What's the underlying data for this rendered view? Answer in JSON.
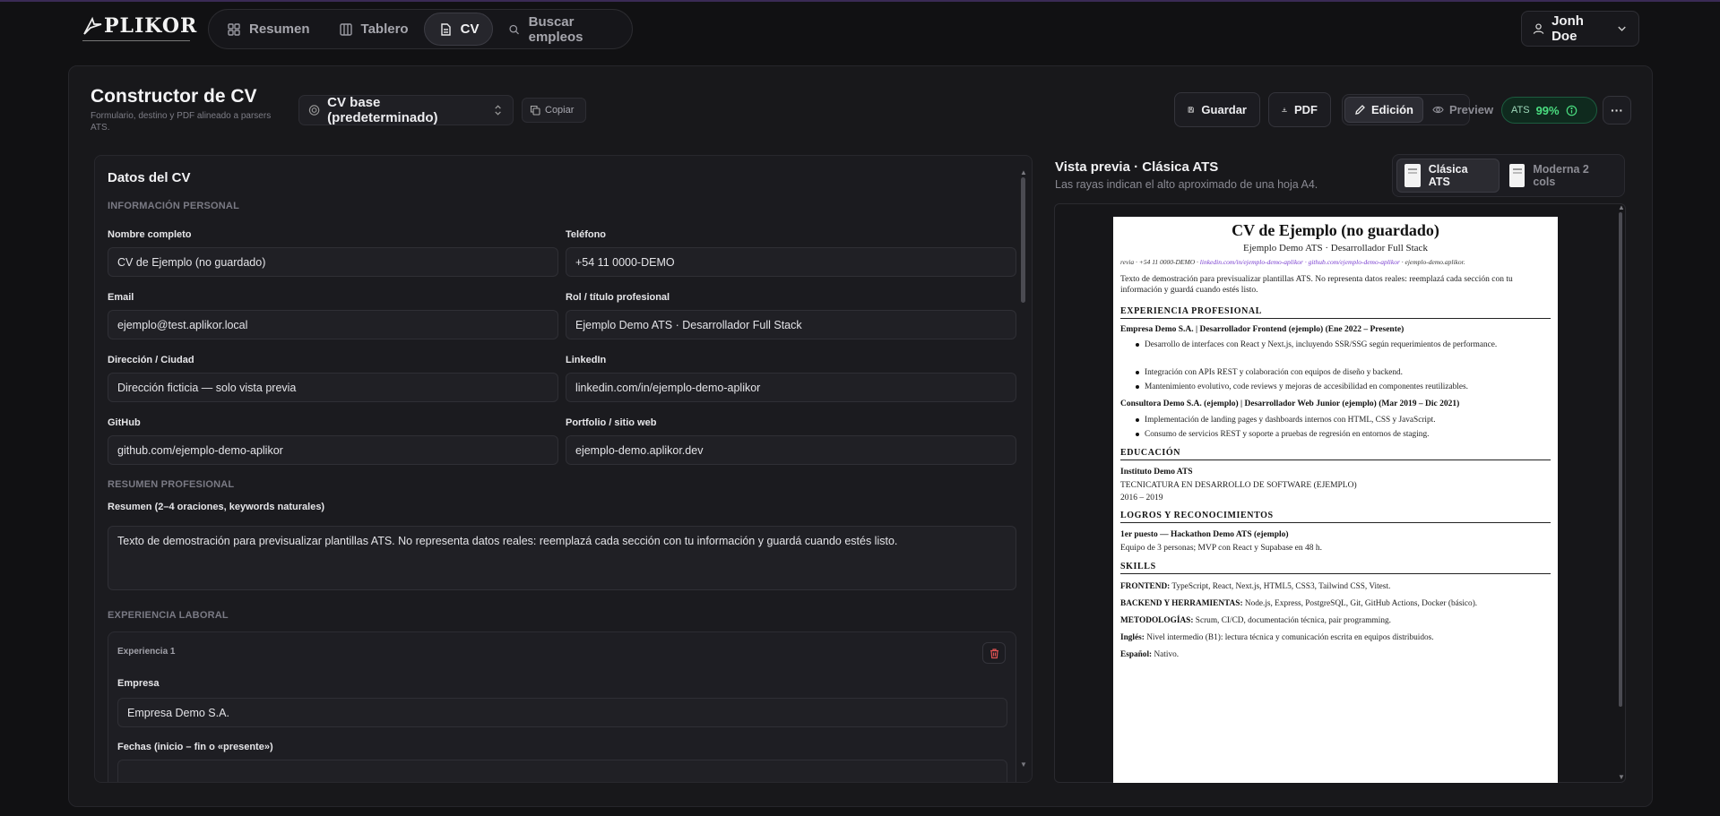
{
  "brand": {
    "name": "PLIKOR"
  },
  "nav": {
    "items": [
      {
        "label": "Resumen",
        "icon": "grid-icon"
      },
      {
        "label": "Tablero",
        "icon": "columns-icon"
      },
      {
        "label": "CV",
        "icon": "file-icon"
      },
      {
        "label": "Buscar empleos",
        "icon": "search-icon"
      }
    ],
    "active": "CV"
  },
  "user": {
    "name": "Jonh Doe"
  },
  "header": {
    "title": "Constructor de CV",
    "subtitle": "Formulario, destino y PDF alineado a parsers ATS.",
    "cv_select": "CV base (predeterminado)",
    "copy_label": "Copiar",
    "save_label": "Guardar",
    "pdf_label": "PDF",
    "edit_label": "Edición",
    "preview_label": "Preview",
    "ats_label": "ATS",
    "ats_score": "99%",
    "more_label": "···"
  },
  "form": {
    "title": "Datos del CV",
    "sections": {
      "personal": "INFORMACIÓN PERSONAL",
      "summary": "RESUMEN PROFESIONAL",
      "experience": "EXPERIENCIA LABORAL"
    },
    "fields": {
      "full_name": {
        "label": "Nombre completo",
        "value": "CV de Ejemplo (no guardado)"
      },
      "phone": {
        "label": "Teléfono",
        "value": "+54 11 0000-DEMO"
      },
      "email": {
        "label": "Email",
        "value": "ejemplo@test.aplikor.local"
      },
      "role": {
        "label": "Rol / título profesional",
        "value": "Ejemplo Demo ATS · Desarrollador Full Stack"
      },
      "address": {
        "label": "Dirección / Ciudad",
        "value": "Dirección ficticia — solo vista previa"
      },
      "linkedin": {
        "label": "LinkedIn",
        "value": "linkedin.com/in/ejemplo-demo-aplikor"
      },
      "github": {
        "label": "GitHub",
        "value": "github.com/ejemplo-demo-aplikor"
      },
      "portfolio": {
        "label": "Portfolio / sitio web",
        "value": "ejemplo-demo.aplikor.dev"
      },
      "summary": {
        "label": "Resumen (2–4 oraciones, keywords naturales)",
        "value": "Texto de demostración para previsualizar plantillas ATS. No representa datos reales: reemplazá cada sección con tu información y guardá cuando estés listo."
      }
    },
    "experience": {
      "card_title": "Experiencia 1",
      "company_label": "Empresa",
      "company_value": "Empresa Demo S.A.",
      "dates_label": "Fechas (inicio – fin o «presente»)"
    }
  },
  "preview": {
    "title": "Vista previa · Clásica ATS",
    "subtitle": "Las rayas indican el alto aproximado de una hoja A4.",
    "templates": [
      "Clásica ATS",
      "Moderna 2 cols"
    ],
    "active_template": "Clásica ATS",
    "sheet": {
      "name": "CV de Ejemplo (no guardado)",
      "role": "Ejemplo Demo ATS · Desarrollador Full Stack",
      "contact_lead": "revia · +54 11 0000-DEMO · ",
      "contact_links": "linkedin.com/in/ejemplo-demo-aplikor · github.com/ejemplo-demo-aplikor",
      "contact_tail": " · ejemplo-demo.aplikor.",
      "summary": "Texto de demostración para previsualizar plantillas ATS. No representa datos reales: reemplazá cada sección con tu información y guardá cuando estés listo.",
      "h_experience": "EXPERIENCIA PROFESIONAL",
      "job1_title": "Empresa Demo S.A. | Desarrollador Frontend (ejemplo) (Ene 2022 – Presente)",
      "job1_bullets": [
        "Desarrollo de interfaces con React y Next.js, incluyendo SSR/SSG según requerimientos de performance.",
        "Integración con APIs REST y colaboración con equipos de diseño y backend.",
        "Mantenimiento evolutivo, code reviews y mejoras de accesibilidad en componentes reutilizables."
      ],
      "job2_title": "Consultora Demo S.A. (ejemplo) | Desarrollador Web Junior (ejemplo) (Mar 2019 – Dic 2021)",
      "job2_bullets": [
        "Implementación de landing pages y dashboards internos con HTML, CSS y JavaScript.",
        "Consumo de servicios REST y soporte a pruebas de regresión en entornos de staging."
      ],
      "h_education": "EDUCACIÓN",
      "edu_school": "Instituto Demo ATS",
      "edu_degree": "TECNICATURA EN DESARROLLO DE SOFTWARE (EJEMPLO)",
      "edu_dates": "2016 – 2019",
      "h_awards": "LOGROS Y RECONOCIMIENTOS",
      "award_title": "1er puesto — Hackathon Demo ATS (ejemplo)",
      "award_desc": "Equipo de 3 personas; MVP con React y Supabase en 48 h.",
      "h_skills": "SKILLS",
      "skills": [
        {
          "k": "FRONTEND:",
          "v": " TypeScript, React, Next.js, HTML5, CSS3, Tailwind CSS, Vitest."
        },
        {
          "k": "BACKEND Y HERRAMIENTAS:",
          "v": " Node.js, Express, PostgreSQL, Git, GitHub Actions, Docker (básico)."
        },
        {
          "k": "METODOLOGÍAS:",
          "v": " Scrum, CI/CD, documentación técnica, pair programming."
        },
        {
          "k": "Inglés:",
          "v": " Nivel intermedio (B1): lectura técnica y comunicación escrita en equipos distribuidos."
        },
        {
          "k": "Español:",
          "v": " Nativo."
        }
      ]
    }
  },
  "colors": {
    "accent_green": "#4ade80",
    "link_purple": "#7a3fd0",
    "danger": "#e05252"
  }
}
